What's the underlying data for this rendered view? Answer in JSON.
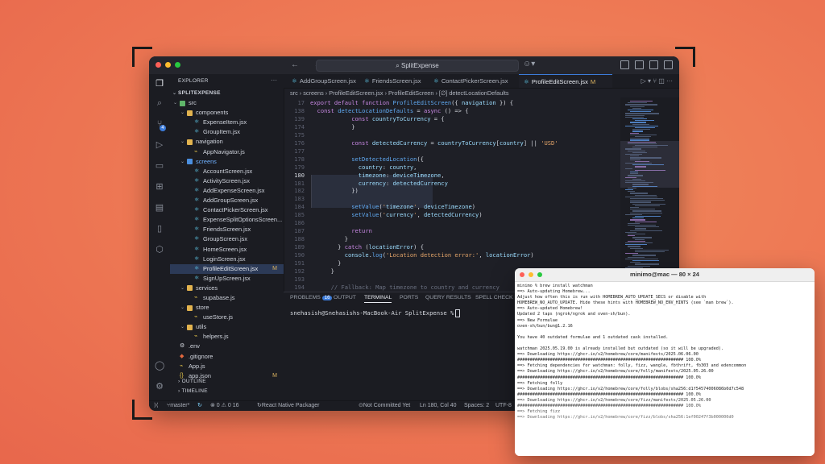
{
  "window": {
    "search_label": "SplitExpense",
    "nav_arrows": "← →"
  },
  "sidebar": {
    "title": "EXPLORER",
    "project": "SPLITEXPENSE",
    "tree": [
      {
        "label": "src",
        "type": "folder",
        "depth": 1,
        "open": true,
        "kind": "src"
      },
      {
        "label": "components",
        "type": "folder",
        "depth": 2,
        "open": true,
        "kind": "folder"
      },
      {
        "label": "ExpenseItem.jsx",
        "type": "file",
        "depth": 3
      },
      {
        "label": "GroupItem.jsx",
        "type": "file",
        "depth": 3
      },
      {
        "label": "navigation",
        "type": "folder",
        "depth": 2,
        "open": true,
        "kind": "folder"
      },
      {
        "label": "AppNavigator.js",
        "type": "js",
        "depth": 3
      },
      {
        "label": "screens",
        "type": "folder",
        "depth": 2,
        "open": true,
        "kind": "scr"
      },
      {
        "label": "AccountScreen.jsx",
        "type": "file",
        "depth": 3
      },
      {
        "label": "ActivityScreen.jsx",
        "type": "file",
        "depth": 3
      },
      {
        "label": "AddExpenseScreen.jsx",
        "type": "file",
        "depth": 3
      },
      {
        "label": "AddGroupScreen.jsx",
        "type": "file",
        "depth": 3
      },
      {
        "label": "ContactPickerScreen.jsx",
        "type": "file",
        "depth": 3
      },
      {
        "label": "ExpenseSplitOptionsScreen...",
        "type": "file",
        "depth": 3
      },
      {
        "label": "FriendsScreen.jsx",
        "type": "file",
        "depth": 3
      },
      {
        "label": "GroupScreen.jsx",
        "type": "file",
        "depth": 3
      },
      {
        "label": "HomeScreen.jsx",
        "type": "file",
        "depth": 3
      },
      {
        "label": "LoginScreen.jsx",
        "type": "file",
        "depth": 3
      },
      {
        "label": "ProfileEditScreen.jsx",
        "type": "file",
        "depth": 3,
        "selected": true,
        "mod": "M"
      },
      {
        "label": "SignUpScreen.jsx",
        "type": "file",
        "depth": 3
      },
      {
        "label": "services",
        "type": "folder",
        "depth": 2,
        "open": true,
        "kind": "folder"
      },
      {
        "label": "supabase.js",
        "type": "js",
        "depth": 3
      },
      {
        "label": "store",
        "type": "folder",
        "depth": 2,
        "open": true,
        "kind": "folder"
      },
      {
        "label": "useStore.js",
        "type": "js",
        "depth": 3
      },
      {
        "label": "utils",
        "type": "folder",
        "depth": 2,
        "open": true,
        "kind": "folder"
      },
      {
        "label": "helpers.js",
        "type": "js",
        "depth": 3
      },
      {
        "label": ".env",
        "type": "env",
        "depth": 1
      },
      {
        "label": ".gitignore",
        "type": "git",
        "depth": 1
      },
      {
        "label": "App.js",
        "type": "js",
        "depth": 1
      },
      {
        "label": "app.json",
        "type": "json",
        "depth": 1,
        "mod": "M"
      }
    ],
    "outline": "OUTLINE",
    "timeline": "TIMELINE"
  },
  "tabs": [
    {
      "label": "AddGroupScreen.jsx"
    },
    {
      "label": "FriendsScreen.jsx"
    },
    {
      "label": "ContactPickerScreen.jsx"
    },
    {
      "label": "ProfileEditScreen.jsx",
      "active": true,
      "mod": "M"
    }
  ],
  "breadcrumb": "src › screens › ProfileEditScreen.jsx › ProfileEditScreen › [∅] detectLocationDefaults",
  "editor": {
    "current_line": 180,
    "lines": [
      {
        "n": "17",
        "code": "export default function ProfileEditScreen({ navigation }) {"
      },
      {
        "n": "138",
        "code": "  const detectLocationDefaults = async () => {"
      },
      {
        "n": "139",
        "code": "            const countryToCurrency = {"
      },
      {
        "n": "174",
        "code": "            }"
      },
      {
        "n": "175",
        "code": ""
      },
      {
        "n": "176",
        "code": "            const detectedCurrency = countryToCurrency[country] || 'USD'"
      },
      {
        "n": "177",
        "code": ""
      },
      {
        "n": "178",
        "code": "            setDetectedLocation({"
      },
      {
        "n": "179",
        "code": "              country: country,"
      },
      {
        "n": "180",
        "code": "              timezone: deviceTimezone,"
      },
      {
        "n": "181",
        "code": "              currency: detectedCurrency"
      },
      {
        "n": "182",
        "code": "            })"
      },
      {
        "n": "183",
        "code": ""
      },
      {
        "n": "184",
        "code": "            setValue('timezone', deviceTimezone)"
      },
      {
        "n": "185",
        "code": "            setValue('currency', detectedCurrency)"
      },
      {
        "n": "186",
        "code": ""
      },
      {
        "n": "187",
        "code": "            return"
      },
      {
        "n": "188",
        "code": "          }"
      },
      {
        "n": "189",
        "code": "        } catch (locationError) {"
      },
      {
        "n": "190",
        "code": "          console.log('Location detection error:', locationError)"
      },
      {
        "n": "191",
        "code": "        }"
      },
      {
        "n": "192",
        "code": "      }"
      },
      {
        "n": "193",
        "code": ""
      },
      {
        "n": "194",
        "code": "      // Fallback: Map timezone to country and currency"
      }
    ]
  },
  "panel": {
    "tabs": [
      "PROBLEMS",
      "OUTPUT",
      "TERMINAL",
      "PORTS",
      "QUERY RESULTS",
      "SPELL CHECK"
    ],
    "problems_count": "16",
    "active": "TERMINAL",
    "prompt": "snehasish@Snehasishs-MacBook-Air SplitExpense %"
  },
  "status": {
    "branch": "master*",
    "counts": "⊗ 0 ⚠ 0  16",
    "packager": "React Native Packager",
    "commit": "Not Committed Yet",
    "position": "Ln 180, Col 40",
    "spaces": "Spaces: 2",
    "encoding": "UTF-8"
  },
  "terminal": {
    "title": "minimo@mac — 80 × 24",
    "lines": [
      "minimo % brew install watchman",
      "==> Auto-updating Homebrew...",
      "Adjust how often this is run with HOMEBREW_AUTO_UPDATE_SECS or disable with",
      "HOMEBREW_NO_AUTO_UPDATE. Hide these hints with HOMEBREW_NO_ENV_HINTS (see `man brew`).",
      "==> Auto-updated Homebrew!",
      "Updated 2 taps (ngrok/ngrok and oven-sh/bun).",
      "==> New Formulae",
      "oven-sh/bun/bun@1.2.16",
      "",
      "You have 40 outdated formulae and 1 outdated cask installed.",
      "",
      "watchman 2025.05.19.00 is already installed but outdated (so it will be upgraded).",
      "==> Downloading https://ghcr.io/v2/homebrew/core/manifests/2025.06.06.00",
      "################################################################## 100.0%",
      "==> Fetching dependencies for watchman: folly, fizz, wangle, fbthrift, fb303 and edencommon",
      "==> Downloading https://ghcr.io/v2/homebrew/core/folly/manifests/2025.05.26.00",
      "################################################################## 100.0%",
      "==> Fetching folly",
      "==> Downloading https://ghcr.io/v2/homebrew/core/folly/blobs/sha256:d1f54574006086b0d7c548",
      "################################################################## 100.0%",
      "==> Downloading https://ghcr.io/v2/homebrew/core/fizz/manifests/2025.05.26.00",
      "################################################################## 100.0%",
      "==> Fetching fizz",
      "==> Downloading https://ghcr.io/v2/homebrew/core/fizz/blobs/sha256:1ef00247f3b000000d0"
    ]
  },
  "colors": {
    "background": "#ee7a55",
    "accent": "#3c7bd9",
    "modified": "#d9b15f"
  }
}
